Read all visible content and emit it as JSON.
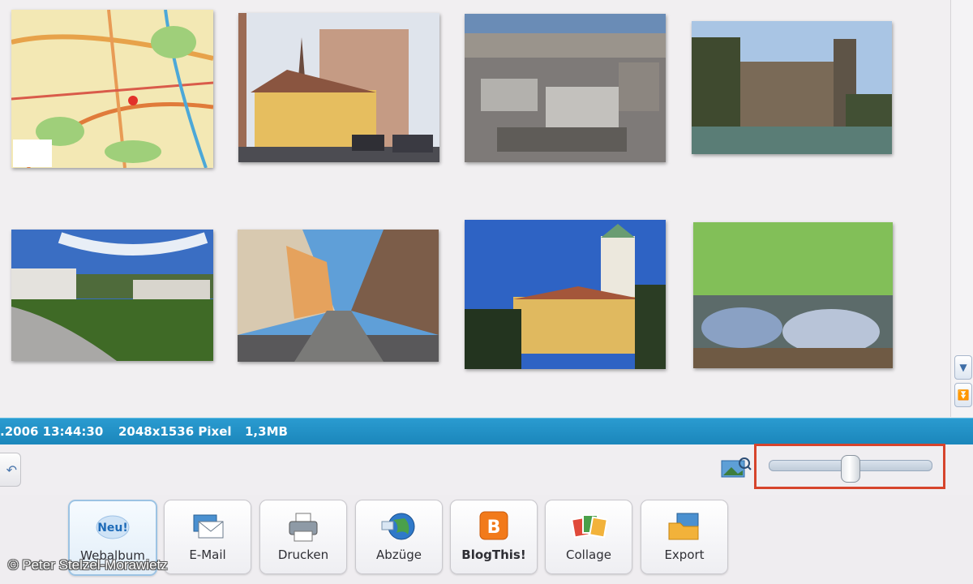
{
  "status_bar": {
    "datetime": ".2006 13:44:30",
    "dimensions": "2048x1536 Pixel",
    "filesize": "1,3MB"
  },
  "thumbnails": [
    {
      "subject": "city map"
    },
    {
      "subject": "street with yellow house and church spires"
    },
    {
      "subject": "aerial city view"
    },
    {
      "subject": "museum building by the river"
    },
    {
      "subject": "neoclassical square with lawn"
    },
    {
      "subject": "long city street"
    },
    {
      "subject": "baroque building with tower"
    },
    {
      "subject": "crowded beer garden"
    }
  ],
  "zoom": {
    "level": 0.5
  },
  "toolbar": {
    "buttons": [
      {
        "badge": "Neu!",
        "label": "Webalbum",
        "icon": "web-album-icon"
      },
      {
        "label": "E-Mail",
        "icon": "email-icon"
      },
      {
        "label": "Drucken",
        "icon": "printer-icon"
      },
      {
        "label": "Abzüge",
        "icon": "globe-icon"
      },
      {
        "label": "BlogThis!",
        "icon": "blogger-icon"
      },
      {
        "label": "Collage",
        "icon": "collage-icon"
      },
      {
        "label": "Export",
        "icon": "export-folder-icon"
      }
    ]
  },
  "copyright": "© Peter Stelzel-Morawietz",
  "colors": {
    "status_bar": "#1f8ec5",
    "highlight": "#d6442c"
  }
}
